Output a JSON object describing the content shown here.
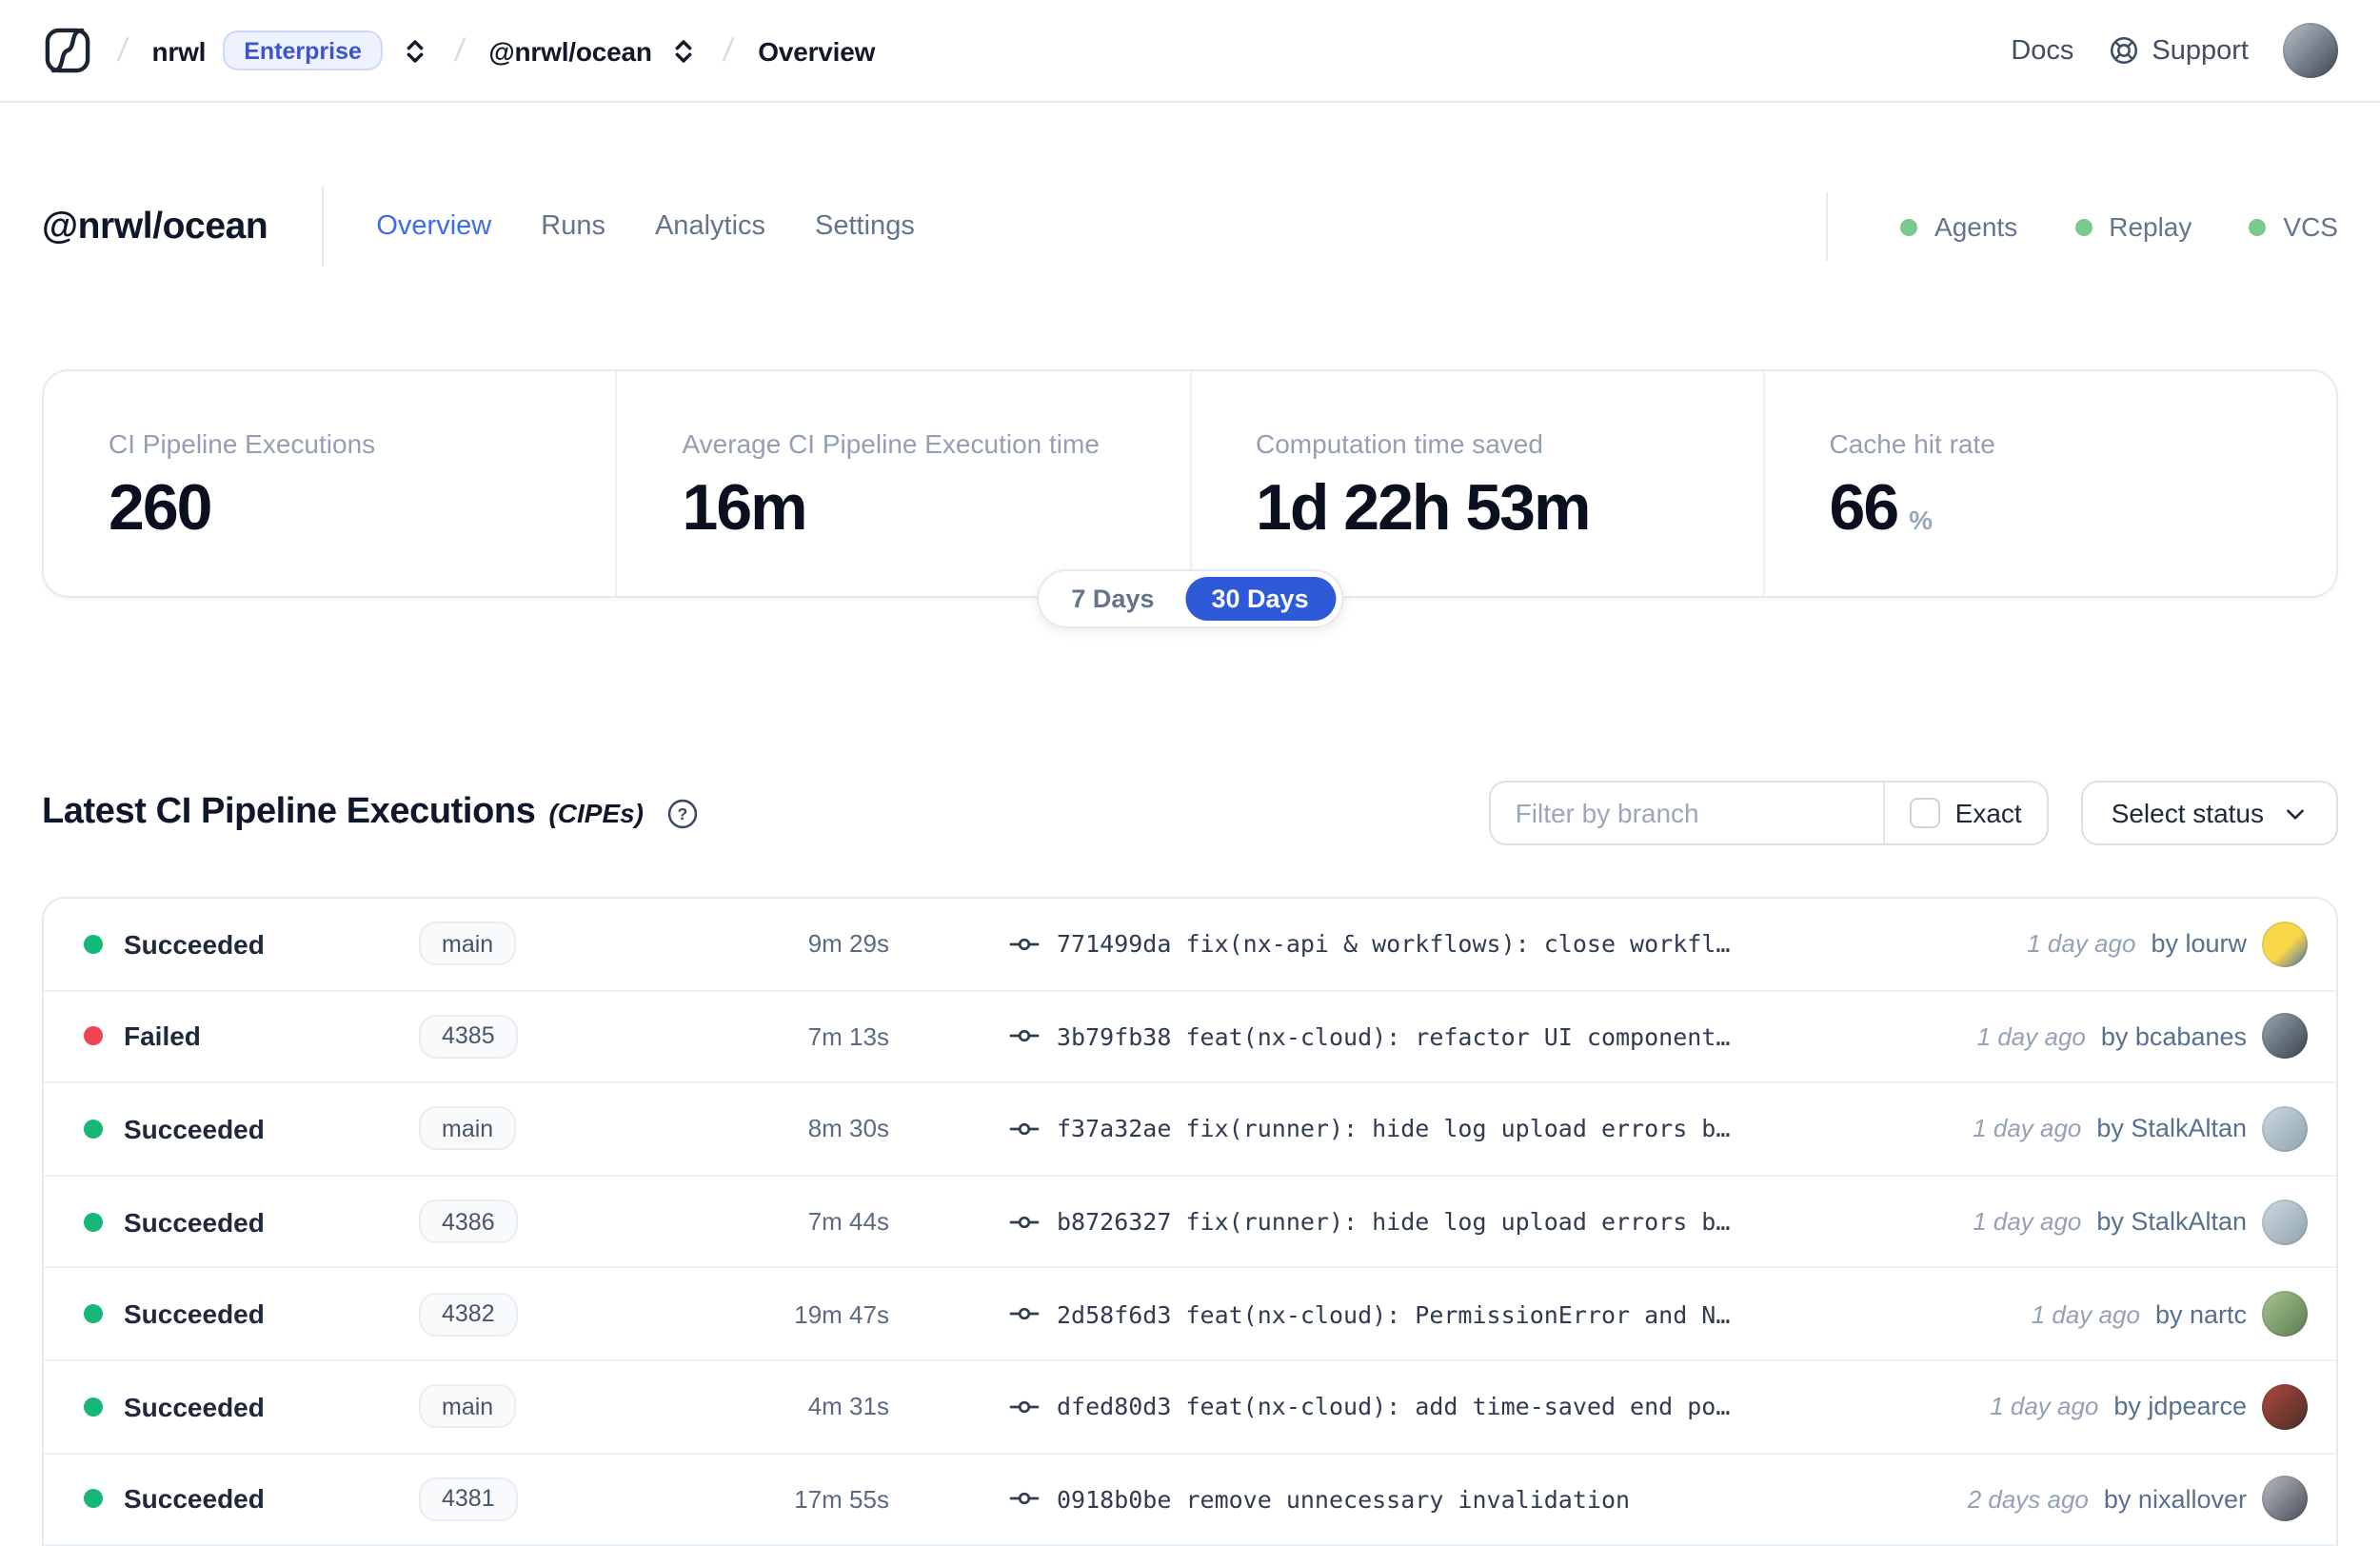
{
  "colors": {
    "accent_blue": "#2e59d9",
    "tab_active_blue": "#3b6bf0",
    "enterprise_blue": "#3a56c9",
    "status_green": "#17b877",
    "status_red": "#ee4350",
    "indicator_green": "#7bc98c"
  },
  "nav": {
    "org": "nrwl",
    "org_badge": "Enterprise",
    "workspace": "@nrwl/ocean",
    "page": "Overview",
    "docs": "Docs",
    "support": "Support"
  },
  "header": {
    "title": "@nrwl/ocean",
    "tabs": [
      {
        "label": "Overview",
        "color": "#3b6bf0"
      },
      {
        "label": "Runs",
        "color": "#64748b"
      },
      {
        "label": "Analytics",
        "color": "#64748b"
      },
      {
        "label": "Settings",
        "color": "#64748b"
      }
    ],
    "indicators": [
      {
        "label": "Agents"
      },
      {
        "label": "Replay"
      },
      {
        "label": "VCS"
      }
    ]
  },
  "stats": [
    {
      "label": "CI Pipeline Executions",
      "value": "260",
      "suffix": ""
    },
    {
      "label": "Average CI Pipeline Execution time",
      "value": "16m",
      "suffix": ""
    },
    {
      "label": "Computation time saved",
      "value": "1d 22h 53m",
      "suffix": ""
    },
    {
      "label": "Cache hit rate",
      "value": "66",
      "suffix": "%"
    }
  ],
  "range_toggle": [
    {
      "label": "7 Days",
      "bg": "transparent",
      "color": "#64748b"
    },
    {
      "label": "30 Days",
      "bg": "#2e59d9",
      "color": "#ffffff"
    }
  ],
  "section": {
    "title": "Latest CI Pipeline Executions",
    "subtitle": "(CIPEs)"
  },
  "filters": {
    "branch_placeholder": "Filter by branch",
    "exact_label": "Exact",
    "status_label": "Select status"
  },
  "table": {
    "rows": [
      {
        "status": "Succeeded",
        "status_color": "#17b877",
        "branch": "main",
        "duration": "9m 29s",
        "commit": "771499da fix(nx-api & workflows): close workfl…",
        "time_ago": "1 day ago",
        "author": "by lourw",
        "avatar_bg": "linear-gradient(135deg,#f8d748 55%,#3e6db5 100%)"
      },
      {
        "status": "Failed",
        "status_color": "#ee4350",
        "branch": "4385",
        "duration": "7m 13s",
        "commit": "3b79fb38 feat(nx-cloud): refactor UI component…",
        "time_ago": "1 day ago",
        "author": "by bcabanes",
        "avatar_bg": "linear-gradient(135deg,#9aa7b5 0%,#39424d 100%)"
      },
      {
        "status": "Succeeded",
        "status_color": "#17b877",
        "branch": "main",
        "duration": "8m 30s",
        "commit": "f37a32ae fix(runner): hide log upload errors b…",
        "time_ago": "1 day ago",
        "author": "by StalkAltan",
        "avatar_bg": "linear-gradient(135deg,#cdd9e0 0%,#8fa3b0 100%)"
      },
      {
        "status": "Succeeded",
        "status_color": "#17b877",
        "branch": "4386",
        "duration": "7m 44s",
        "commit": "b8726327 fix(runner): hide log upload errors b…",
        "time_ago": "1 day ago",
        "author": "by StalkAltan",
        "avatar_bg": "linear-gradient(135deg,#cdd9e0 0%,#8fa3b0 100%)"
      },
      {
        "status": "Succeeded",
        "status_color": "#17b877",
        "branch": "4382",
        "duration": "19m 47s",
        "commit": "2d58f6d3 feat(nx-cloud): PermissionError and N…",
        "time_ago": "1 day ago",
        "author": "by nartc",
        "avatar_bg": "linear-gradient(135deg,#a8c78f 0%,#5c7a52 100%)"
      },
      {
        "status": "Succeeded",
        "status_color": "#17b877",
        "branch": "main",
        "duration": "4m 31s",
        "commit": "dfed80d3 feat(nx-cloud): add time-saved end po…",
        "time_ago": "1 day ago",
        "author": "by jdpearce",
        "avatar_bg": "linear-gradient(135deg,#b0493c 0%,#4a2e28 100%)"
      },
      {
        "status": "Succeeded",
        "status_color": "#17b877",
        "branch": "4381",
        "duration": "17m 55s",
        "commit": "0918b0be remove unnecessary invalidation",
        "time_ago": "2 days ago",
        "author": "by nixallover",
        "avatar_bg": "linear-gradient(135deg,#b9bcc4 0%,#4a4e57 100%)"
      }
    ]
  },
  "nav_avatar_bg": "linear-gradient(135deg,#b9c2cc 0%,#3c4652 100%)"
}
